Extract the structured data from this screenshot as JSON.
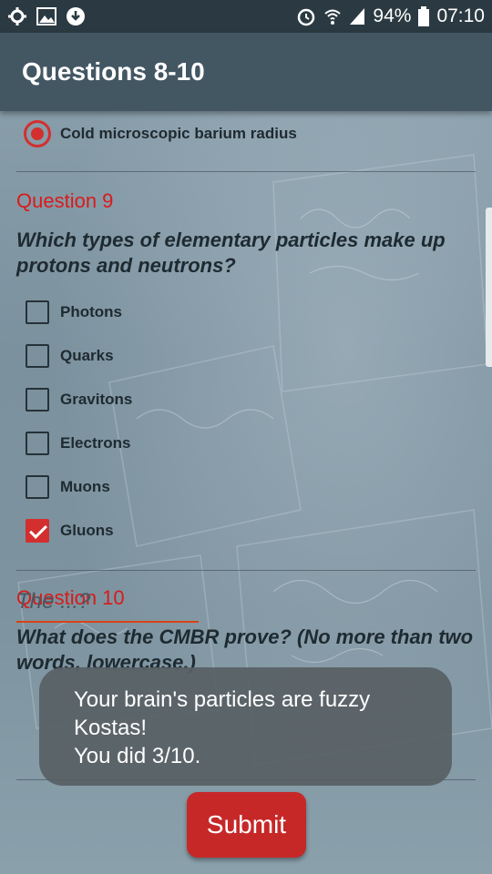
{
  "status_bar": {
    "battery": "94%",
    "time": "07:10",
    "icons": [
      "settings-icon",
      "image-icon",
      "download-icon",
      "alarm-icon",
      "wifi-icon",
      "signal-icon",
      "battery-icon"
    ]
  },
  "app_bar": {
    "title": "Questions 8-10"
  },
  "question8": {
    "selected_option": "Cold microscopic barium radius"
  },
  "question9": {
    "title": "Question 9",
    "text": "Which types of elementary particles make up protons and neutrons?",
    "options": [
      {
        "label": "Photons",
        "checked": false
      },
      {
        "label": "Quarks",
        "checked": false
      },
      {
        "label": "Gravitons",
        "checked": false
      },
      {
        "label": "Electrons",
        "checked": false
      },
      {
        "label": "Muons",
        "checked": false
      },
      {
        "label": "Gluons",
        "checked": true
      }
    ]
  },
  "question10": {
    "title": "Question 10",
    "text": "What does the CMBR prove? (No more than two words, lowercase.)",
    "answer_placeholder": "The ...?"
  },
  "toast": {
    "line1": "Your brain's particles are fuzzy",
    "line2": "Kostas!",
    "line3": "You did 3/10."
  },
  "submit_label": "Submit",
  "colors": {
    "accent": "#d32f2f",
    "app_bar": "#435763",
    "status_bar": "#2b3a42"
  }
}
